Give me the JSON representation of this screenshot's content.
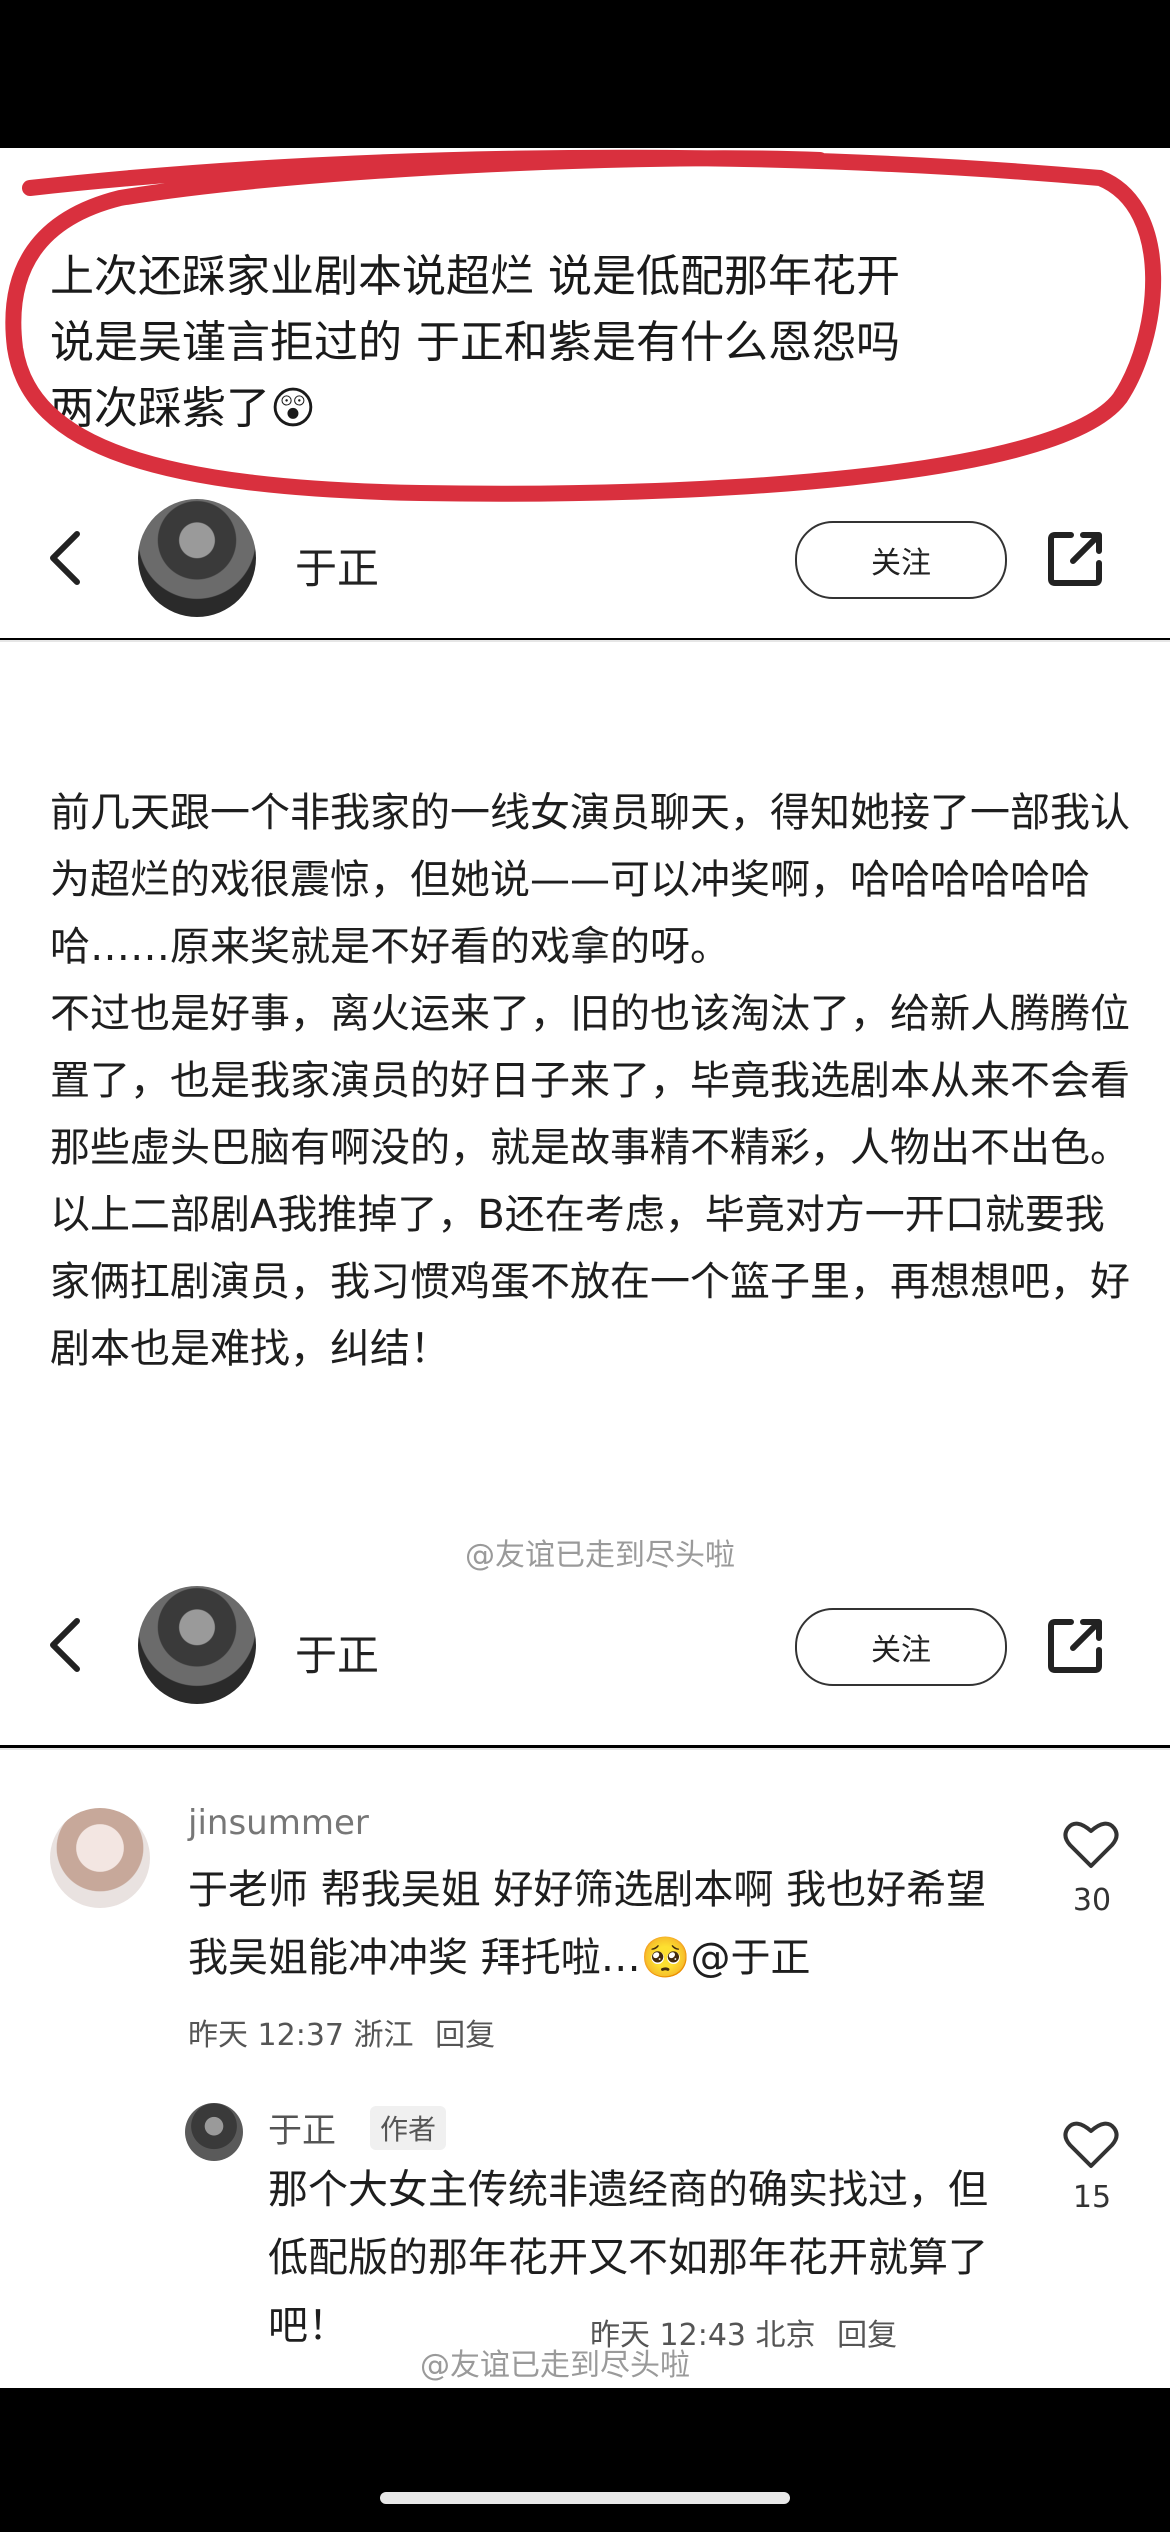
{
  "annotation": {
    "lines": [
      "上次还踩家业剧本说超烂 说是低配那年花开",
      "说是吴谨言拒过的 于正和紫是有什么恩怨吗",
      "两次踩紫了😲"
    ],
    "circle_color": "#d9303e"
  },
  "profile_bar": {
    "name": "于正",
    "follow_label": "关注"
  },
  "post": {
    "paragraphs": [
      "前几天跟一个非我家的一线女演员聊天，得知她接了一部我认为超烂的戏很震惊，但她说——可以冲奖啊，哈哈哈哈哈哈哈……原来奖就是不好看的戏拿的呀。",
      "不过也是好事，离火运来了，旧的也该淘汰了，给新人腾腾位置了，也是我家演员的好日子来了，毕竟我选剧本从来不会看那些虚头巴脑有啊没的，就是故事精不精彩，人物出不出色。",
      "以上二部剧A我推掉了，B还在考虑，毕竟对方一开口就要我家俩扛剧演员，我习惯鸡蛋不放在一个篮子里，再想想吧，好剧本也是难找，纠结！"
    ],
    "watermark": "@友谊已走到尽头啦"
  },
  "profile_bar_2": {
    "name": "于正",
    "follow_label": "关注"
  },
  "comments": [
    {
      "user": "jinsummer",
      "text": "于老师 帮我吴姐 好好筛选剧本啊 我也好希望 我吴姐能冲冲奖 拜托啦…🥺@于正",
      "time": "昨天 12:37",
      "location": "浙江",
      "reply_label": "回复",
      "likes": "30",
      "icon": "heart-outline-icon"
    },
    {
      "user": "于正",
      "badge": "作者",
      "text": "那个大女主传统非遗经商的确实找过，但低配版的那年花开又不如那年花开就算了吧！",
      "time": "昨天 12:43",
      "location": "北京",
      "reply_label": "回复",
      "likes": "15",
      "icon": "heart-outline-icon"
    }
  ],
  "bottom_watermark": "@友谊已走到尽头啦"
}
